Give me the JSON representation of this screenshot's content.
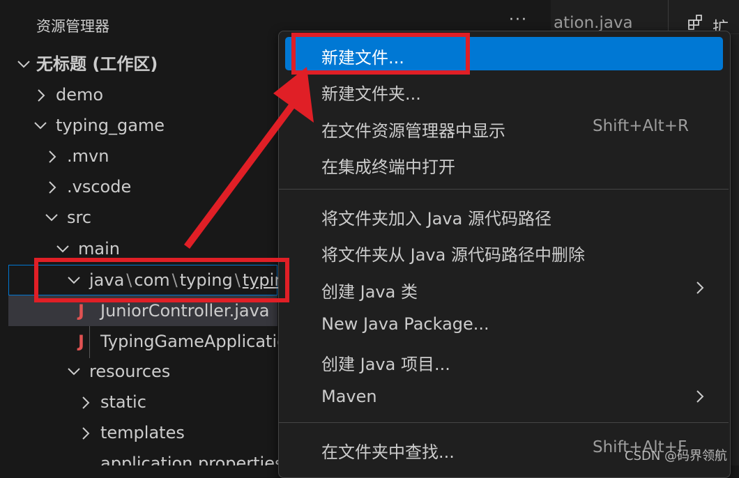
{
  "explorer": {
    "title": "资源管理器",
    "more": "···",
    "tree": [
      {
        "name": "workspace-root",
        "label": "无标题 (工作区)",
        "expanded": true,
        "type": "folder"
      },
      {
        "name": "folder-demo",
        "label": "demo",
        "expanded": false,
        "type": "folder"
      },
      {
        "name": "folder-typing-game",
        "label": "typing_game",
        "expanded": true,
        "type": "folder"
      },
      {
        "name": "folder-mvn",
        "label": ".mvn",
        "expanded": false,
        "type": "folder"
      },
      {
        "name": "folder-vscode",
        "label": ".vscode",
        "expanded": false,
        "type": "folder"
      },
      {
        "name": "folder-src",
        "label": "src",
        "expanded": true,
        "type": "folder"
      },
      {
        "name": "folder-main",
        "label": "main",
        "expanded": true,
        "type": "folder"
      },
      {
        "name": "folder-java-package",
        "label_segments": [
          "java",
          "com",
          "typing",
          "typir"
        ],
        "separator": "\\",
        "expanded": true,
        "type": "folder",
        "focused": true
      },
      {
        "name": "file-junior-controller",
        "label": "JuniorController.java",
        "icon_text": "J",
        "type": "java-file",
        "selected": true
      },
      {
        "name": "file-typing-game-application",
        "label": "TypingGameApplicatic",
        "icon_text": "J",
        "type": "java-file"
      },
      {
        "name": "folder-resources",
        "label": "resources",
        "expanded": true,
        "type": "folder"
      },
      {
        "name": "folder-static",
        "label": "static",
        "expanded": false,
        "type": "folder"
      },
      {
        "name": "folder-templates",
        "label": "templates",
        "expanded": false,
        "type": "folder"
      },
      {
        "name": "file-application-properties",
        "label": "application.properties",
        "icon": "settings-file-icon",
        "type": "file"
      }
    ]
  },
  "editor": {
    "tab1_label": "ation.java",
    "tab2_label": "扩展",
    "tab2_icon": "extensions-icon"
  },
  "context_menu": {
    "items": [
      {
        "name": "menu-new-file",
        "label": "新建文件...",
        "shortcut": "",
        "active": true
      },
      {
        "name": "menu-new-folder",
        "label": "新建文件夹...",
        "shortcut": ""
      },
      {
        "name": "menu-reveal-in-explorer",
        "label": "在文件资源管理器中显示",
        "shortcut": "Shift+Alt+R"
      },
      {
        "name": "menu-open-in-terminal",
        "label": "在集成终端中打开",
        "shortcut": ""
      },
      {
        "name": "menu-add-to-source-path",
        "label": "将文件夹加入 Java 源代码路径",
        "shortcut": ""
      },
      {
        "name": "menu-remove-from-source-path",
        "label": "将文件夹从 Java 源代码路径中删除",
        "shortcut": ""
      },
      {
        "name": "menu-create-java-class",
        "label": "创建 Java 类",
        "shortcut": "",
        "submenu": true
      },
      {
        "name": "menu-new-java-package",
        "label": "New Java Package...",
        "shortcut": ""
      },
      {
        "name": "menu-create-java-project",
        "label": "创建 Java 项目...",
        "shortcut": ""
      },
      {
        "name": "menu-maven",
        "label": "Maven",
        "shortcut": "",
        "submenu": true
      },
      {
        "name": "menu-find-in-folder",
        "label": "在文件夹中查找...",
        "shortcut": "Shift+Alt+F"
      }
    ]
  },
  "watermark": "CSDN @码界领航",
  "colors": {
    "background": "#181818",
    "menu_background": "#1f1f1f",
    "accent": "#0078d4",
    "annotation_red": "#e01f26",
    "java_icon": "#e05252"
  }
}
